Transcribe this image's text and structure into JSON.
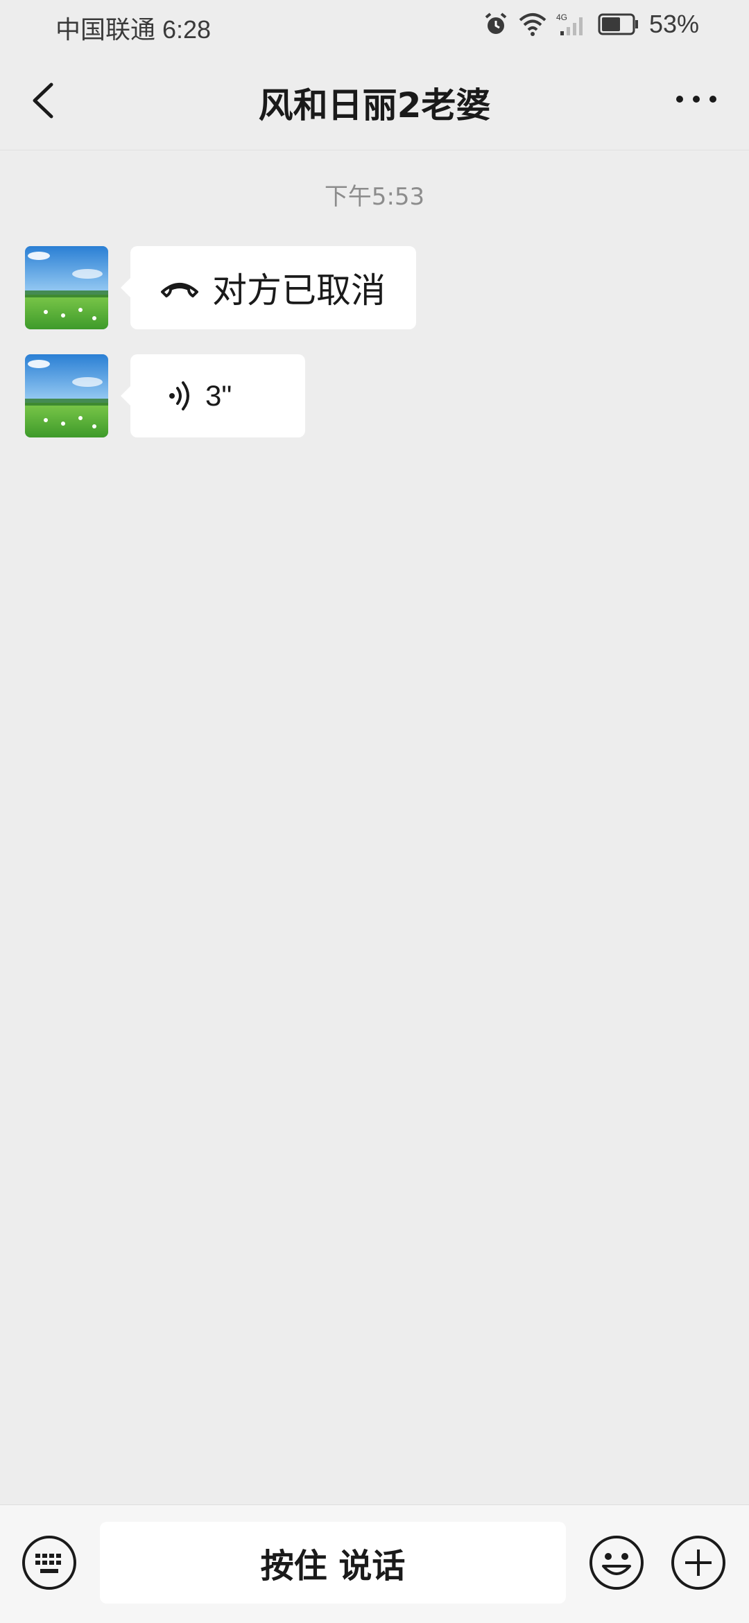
{
  "status_bar": {
    "carrier_time": "中国联通 6:28",
    "battery": "53%"
  },
  "nav": {
    "title": "风和日丽2老婆"
  },
  "chat": {
    "timestamp": "下午5:53",
    "messages": [
      {
        "type": "call",
        "icon": "hangup-phone-icon",
        "text": "对方已取消"
      },
      {
        "type": "voice",
        "icon": "voice-wave-icon",
        "text": "3\""
      }
    ]
  },
  "input_bar": {
    "talk_label": "按住 说话"
  },
  "colors": {
    "background": "#ededed",
    "bubble": "#ffffff",
    "bottom_bar": "#f6f6f6"
  }
}
